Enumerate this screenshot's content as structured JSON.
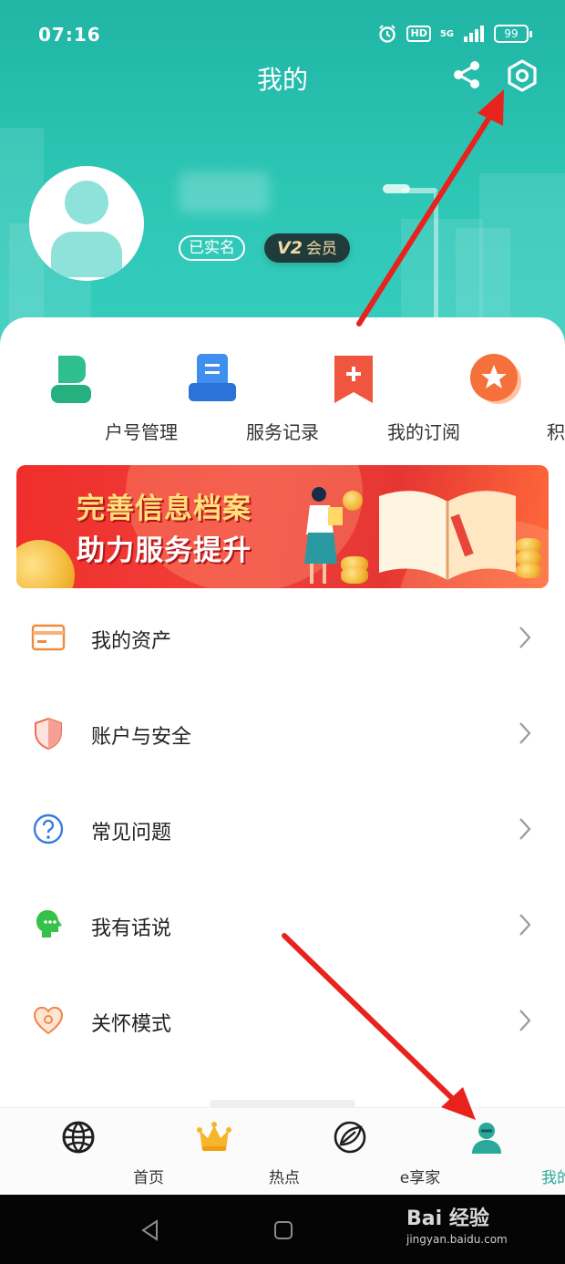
{
  "status_bar": {
    "time": "07:16",
    "hd": "HD",
    "network": "5G",
    "battery": "99"
  },
  "header": {
    "title": "我的"
  },
  "profile": {
    "verified": "已实名",
    "vip_level": "V2",
    "vip_label": "会员"
  },
  "quick_actions": [
    {
      "label": "户号管理",
      "icon": "person-icon"
    },
    {
      "label": "服务记录",
      "icon": "record-icon"
    },
    {
      "label": "我的订阅",
      "icon": "subscription-icon"
    },
    {
      "label": "积分",
      "icon": "star-icon"
    }
  ],
  "banner": {
    "line1": "完善信息档案",
    "line2": "助力服务提升"
  },
  "menu": [
    {
      "label": "我的资产",
      "icon": "wallet-icon"
    },
    {
      "label": "账户与安全",
      "icon": "shield-icon"
    },
    {
      "label": "常见问题",
      "icon": "question-icon"
    },
    {
      "label": "我有话说",
      "icon": "chat-icon"
    },
    {
      "label": "关怀模式",
      "icon": "care-heart-icon"
    }
  ],
  "tabs": [
    {
      "label": "首页",
      "icon": "globe-icon"
    },
    {
      "label": "热点",
      "icon": "crown-icon"
    },
    {
      "label": "e享家",
      "icon": "leaf-icon"
    },
    {
      "label": "我的",
      "icon": "user-icon"
    }
  ],
  "watermark": {
    "main": "Bai 经验",
    "sub": "jingyan.baidu.com"
  },
  "colors": {
    "header": "#2ec7b6",
    "accent": "#2aa99b",
    "banner": "#ef2e2b",
    "arrow": "#e8231e"
  }
}
